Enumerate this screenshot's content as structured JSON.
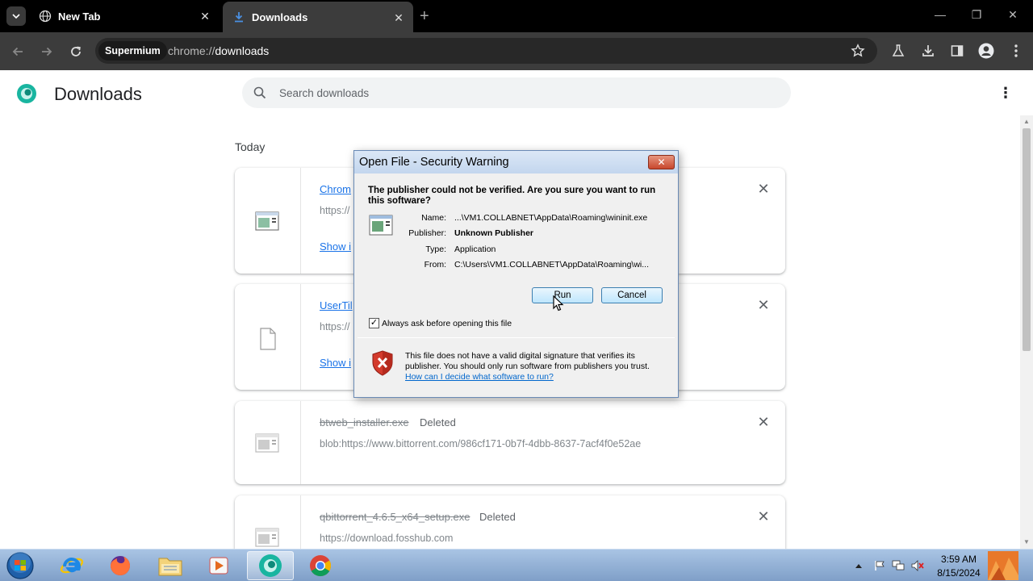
{
  "browser": {
    "tabs": [
      {
        "label": "New Tab",
        "active": false
      },
      {
        "label": "Downloads",
        "active": true
      }
    ],
    "omnibox": {
      "chip": "Supermium",
      "url_scheme": "chrome://",
      "url_host": "downloads"
    }
  },
  "page": {
    "title": "Downloads",
    "search": {
      "placeholder": "Search downloads"
    },
    "section_label": "Today",
    "downloads": [
      {
        "name": "Chrom",
        "url": "https://",
        "action": "Show i",
        "status": ""
      },
      {
        "name": "UserTil",
        "url": "https://",
        "action": "Show i",
        "status": ""
      },
      {
        "name": "btweb_installer.exe",
        "status": "Deleted",
        "url": "blob:https://www.bittorrent.com/986cf171-0b7f-4dbb-8637-7acf4f0e52ae"
      },
      {
        "name": "qbittorrent_4.6.5_x64_setup.exe",
        "status": "Deleted",
        "url": "https://download.fosshub.com"
      }
    ]
  },
  "dialog": {
    "title": "Open File - Security Warning",
    "question": "The publisher could not be verified.  Are you sure you want to run this software?",
    "fields": [
      {
        "label": "Name:",
        "value": "...\\VM1.COLLABNET\\AppData\\Roaming\\wininit.exe"
      },
      {
        "label": "Publisher:",
        "value": "Unknown Publisher"
      },
      {
        "label": "Type:",
        "value": "Application"
      },
      {
        "label": "From:",
        "value": "C:\\Users\\VM1.COLLABNET\\AppData\\Roaming\\wi..."
      }
    ],
    "run_button": "Run",
    "cancel_button": "Cancel",
    "checkbox_label": "Always ask before opening this file",
    "checkbox_checked": true,
    "warning_text": "This file does not have a valid digital signature that verifies its publisher.  You should only run software from publishers you trust.",
    "help_link": "How can I decide what software to run?"
  },
  "taskbar": {
    "time": "3:59 AM",
    "date": "8/15/2024"
  },
  "colors": {
    "link": "#1a73e8",
    "tab_bar": "#000000",
    "toolbar": "#3c3c3c",
    "taskbar": "#8fb0d8"
  }
}
